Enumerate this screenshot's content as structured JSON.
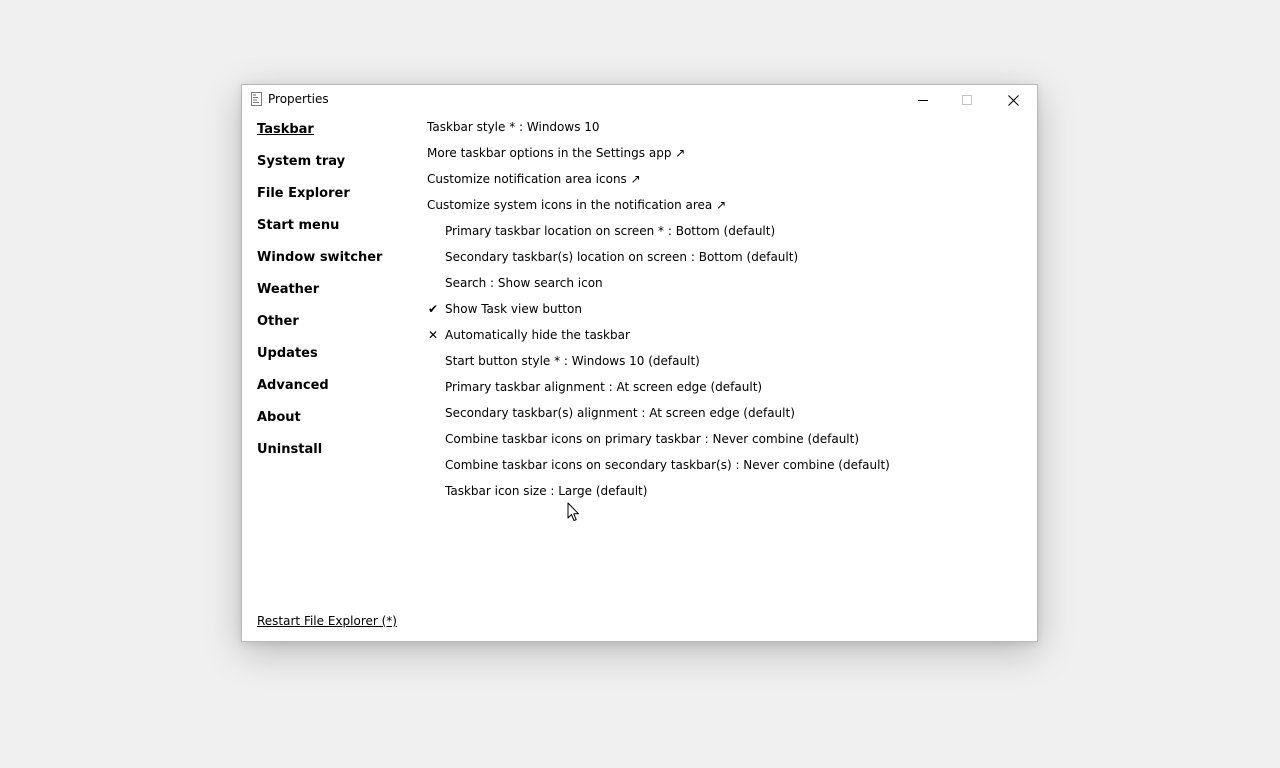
{
  "window": {
    "title": "Properties",
    "app_icon": "properties-app-icon",
    "controls": {
      "minimize": "minimize-icon",
      "maximize": "maximize-icon",
      "close": "close-icon"
    }
  },
  "sidebar": {
    "items": [
      {
        "label": "Taskbar",
        "active": true
      },
      {
        "label": "System tray"
      },
      {
        "label": "File Explorer"
      },
      {
        "label": "Start menu"
      },
      {
        "label": "Window switcher"
      },
      {
        "label": "Weather"
      },
      {
        "label": "Other"
      },
      {
        "label": "Updates"
      },
      {
        "label": "Advanced"
      },
      {
        "label": "About"
      },
      {
        "label": "Uninstall"
      }
    ]
  },
  "content": {
    "rows": [
      {
        "text": "Taskbar style * : Windows 10"
      },
      {
        "text": "More taskbar options in the Settings app ↗"
      },
      {
        "text": "Customize notification area icons ↗"
      },
      {
        "text": "Customize system icons in the notification area ↗"
      },
      {
        "text": "Primary taskbar location on screen * : Bottom (default)"
      },
      {
        "text": "Secondary taskbar(s) location on screen : Bottom (default)"
      },
      {
        "text": "Search : Show search icon"
      },
      {
        "text": "Show Task view button",
        "mark": "✔"
      },
      {
        "text": "Automatically hide the taskbar",
        "mark": "✕"
      },
      {
        "text": "Start button style * : Windows 10 (default)"
      },
      {
        "text": "Primary taskbar alignment : At screen edge (default)"
      },
      {
        "text": "Secondary taskbar(s) alignment : At screen edge (default)"
      },
      {
        "text": "Combine taskbar icons on primary taskbar : Never combine (default)"
      },
      {
        "text": "Combine taskbar icons on secondary taskbar(s) : Never combine (default)"
      },
      {
        "text": "Taskbar icon size : Large (default)"
      }
    ]
  },
  "footer": {
    "restart_label": "Restart File Explorer (*)"
  },
  "colors": {
    "background": "#f0f0f0",
    "window": "#ffffff",
    "border": "#b9b9b9",
    "text": "#000000"
  }
}
